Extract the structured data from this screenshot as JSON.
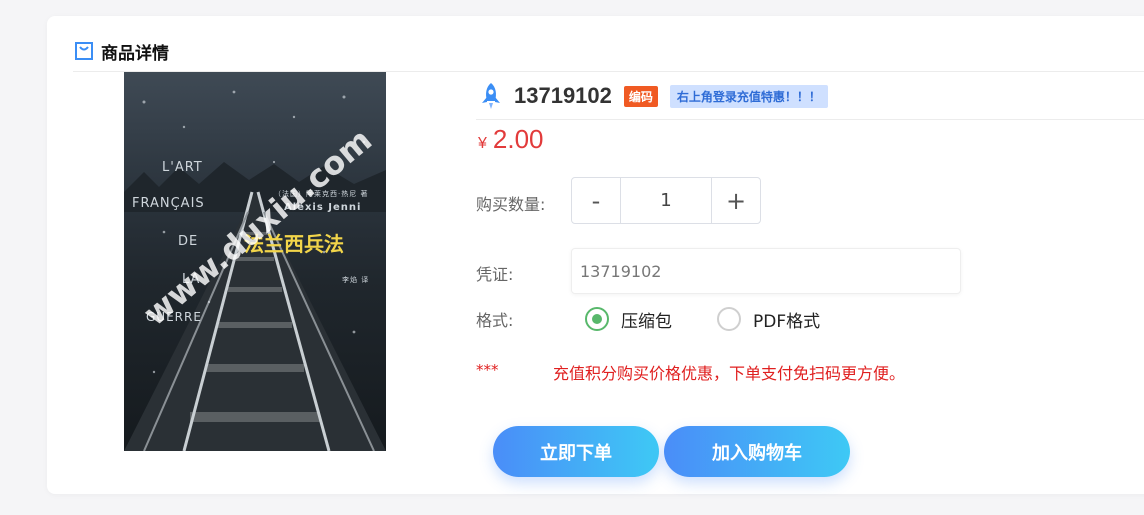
{
  "section": {
    "title": "商品详情",
    "icon": "shopping-bag-icon"
  },
  "cover": {
    "art_text": [
      "L'ART",
      "FRANÇAIS",
      "DE",
      "LA",
      "GUERRE"
    ],
    "byline": "（法国）阿莱克西·热尼 著",
    "author_latin": "Alexis Jenni",
    "book_title": "法兰西兵法",
    "translator": "李焰 译",
    "watermark": "www.duxiu.com"
  },
  "product": {
    "icon": "rocket-icon",
    "code": "13719102",
    "code_badge": "编码",
    "promo_badge": "右上角登录充值特惠！！！"
  },
  "price": {
    "symbol": "¥",
    "value": "2.00"
  },
  "quantity": {
    "label": "购买数量:",
    "minus": "-",
    "value": "1",
    "plus": "+"
  },
  "voucher": {
    "label": "凭证:",
    "value": "13719102"
  },
  "format": {
    "label": "格式:",
    "options": [
      {
        "label": "压缩包",
        "checked": true
      },
      {
        "label": "PDF格式",
        "checked": false
      }
    ]
  },
  "notice": {
    "stars": "***",
    "text": "充值积分购买价格优惠，下单支付免扫码更方便。"
  },
  "actions": {
    "buy_now": "立即下单",
    "add_to_cart": "加入购物车"
  },
  "colors": {
    "price": "#e23b3b",
    "badge_code_bg": "#f05a23",
    "badge_promo_bg": "#cfe0ff",
    "badge_promo_text": "#2f6cd6",
    "radio_checked": "#58b86b",
    "button_gradient_start": "#4a8df8",
    "button_gradient_end": "#3ec9f5"
  }
}
